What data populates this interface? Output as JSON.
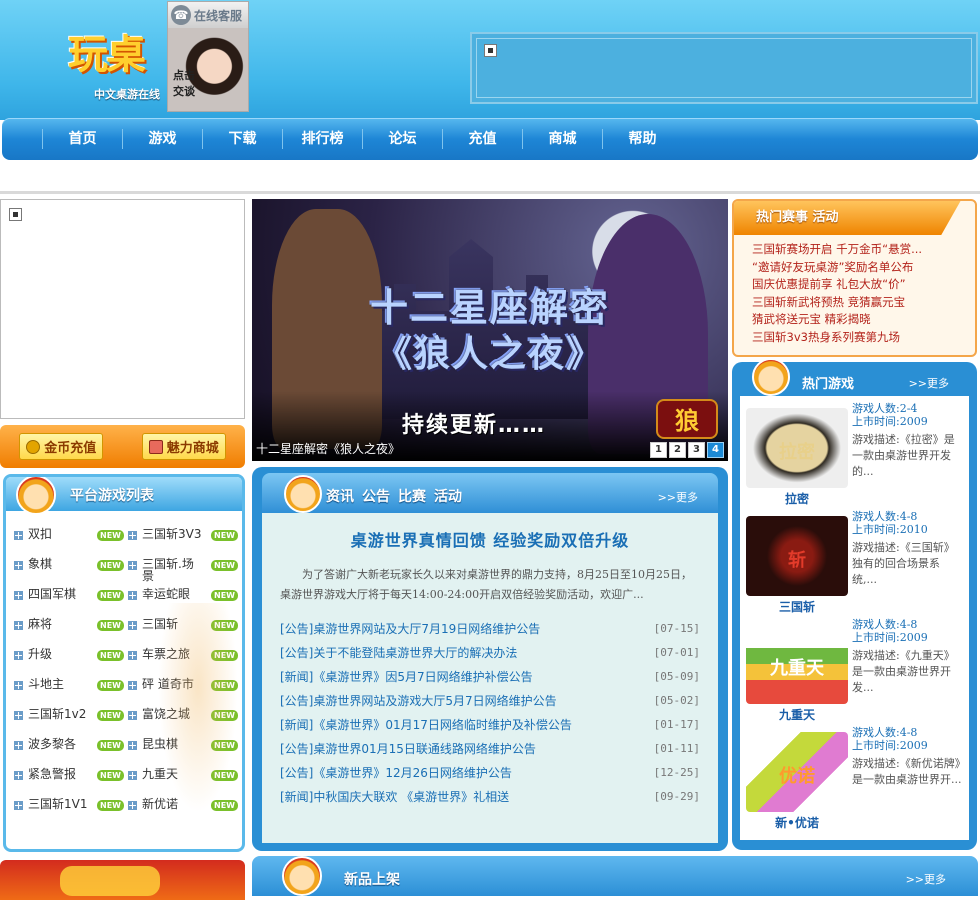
{
  "header": {
    "logo_text": "玩桌",
    "logo_tagline": "中文桌游在线",
    "customer_service": {
      "label": "在线客服",
      "cta": "点击交谈"
    }
  },
  "nav": {
    "items": [
      "首页",
      "游戏",
      "下载",
      "排行榜",
      "论坛",
      "充值",
      "商城",
      "帮助"
    ]
  },
  "shortcuts": {
    "recharge": "金币充值",
    "mall": "魅力商城"
  },
  "platform": {
    "title": "平台游戏列表",
    "new_label": "NEW",
    "games": [
      "双扣",
      "三国斩3V3",
      "象棋",
      "三国斩.场景",
      "四国军棋",
      "幸运蛇眼",
      "麻将",
      "三国斩",
      "升级",
      "车票之旅",
      "斗地主",
      "砰 道奇市",
      "三国斩1v2",
      "富饶之城",
      "波多黎各",
      "昆虫棋",
      "紧急警报",
      "九重天",
      "三国斩1V1",
      "新优诺"
    ]
  },
  "banner": {
    "title_line1": "十二星座解密",
    "title_line2": "《狼人之夜》",
    "subtitle": "持续更新……",
    "stamp": "狼",
    "caption": "十二星座解密《狼人之夜》",
    "pages": [
      "1",
      "2",
      "3",
      "4"
    ],
    "active_page": "4"
  },
  "news": {
    "tabs": [
      "资讯",
      "公告",
      "比赛",
      "活动"
    ],
    "more": ">>更多",
    "feature_title": "桌游世界真情回馈 经验奖励双倍升级",
    "feature_body": "为了答谢广大新老玩家长久以来对桌游世界的鼎力支持，8月25日至10月25日，桌游世界游戏大厅将于每天14:00-24:00开启双倍经验奖励活动，欢迎广...",
    "items": [
      {
        "title": "[公告]桌游世界网站及大厅7月19日网络维护公告",
        "date": "[07-15]"
      },
      {
        "title": "[公告]关于不能登陆桌游世界大厅的解决办法",
        "date": "[07-01]"
      },
      {
        "title": "[新闻]《桌游世界》因5月7日网络维护补偿公告",
        "date": "[05-09]"
      },
      {
        "title": "[公告]桌游世界网站及游戏大厅5月7日网络维护公告",
        "date": "[05-02]"
      },
      {
        "title": "[新闻]《桌游世界》01月17日网络临时维护及补偿公告",
        "date": "[01-17]"
      },
      {
        "title": "[公告]桌游世界01月15日联通线路网络维护公告",
        "date": "[01-11]"
      },
      {
        "title": "[公告]《桌游世界》12月26日网络维护公告",
        "date": "[12-25]"
      },
      {
        "title": "[新闻]中秋国庆大联欢 《桌游世界》礼相送",
        "date": "[09-29]"
      }
    ]
  },
  "new_products": {
    "title": "新品上架",
    "more": ">>更多"
  },
  "events": {
    "title": "热门赛事 活动",
    "items": [
      "三国斩赛场开启 千万金币“悬赏...",
      "“邀请好友玩桌游”奖励名单公布",
      "国庆优惠提前享 礼包大放“价”",
      "三国斩新武将预热 竞猜赢元宝",
      "猜武将送元宝 精彩揭晓",
      "三国斩3v3热身系列赛第九场"
    ]
  },
  "hot_games": {
    "title": "热门游戏",
    "more": ">>更多",
    "players_label": "游戏人数:",
    "date_label": "上市时间:",
    "desc_label": "游戏描述:",
    "games": [
      {
        "name": "拉密",
        "thumb_text": "拉密",
        "players": "2-4",
        "year": "2009",
        "desc": "《拉密》是一款由桌游世界开发的..."
      },
      {
        "name": "三国斩",
        "thumb_text": "斩",
        "players": "4-8",
        "year": "2010",
        "desc": "《三国斩》独有的回合场景系统,..."
      },
      {
        "name": "九重天",
        "thumb_text": "九重天",
        "players": "4-8",
        "year": "2009",
        "desc": "《九重天》是一款由桌游世界开发..."
      },
      {
        "name": "新•优诺",
        "thumb_text": "优诺",
        "players": "4-8",
        "year": "2009",
        "desc": "《新优诺牌》是一款由桌游世界开..."
      }
    ]
  }
}
